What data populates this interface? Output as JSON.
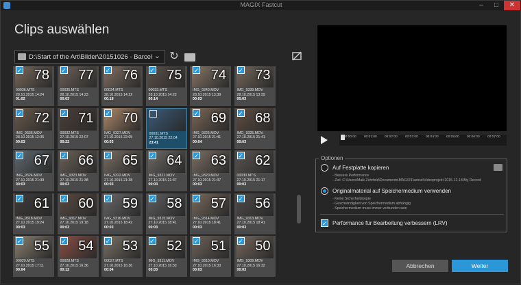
{
  "window": {
    "title": "MAGIX Fastcut",
    "min": "–",
    "max": "□",
    "close": "✕"
  },
  "heading": "Clips auswählen",
  "path": {
    "value": "D:\\Start of the Art\\Bilder\\20151026 - Barcelona\\Vid",
    "caret": "⌄"
  },
  "icons": {
    "refresh": "refresh-icon",
    "browse": "folder-icon",
    "no_preview": "no-preview-icon"
  },
  "clips": [
    {
      "n": "78",
      "name": "00036.MTS",
      "date": "28.10.2015 14:24",
      "dur": "01:02",
      "checked": true,
      "color": "#7d6a5a"
    },
    {
      "n": "77",
      "name": "00035.MTS",
      "date": "28.10.2015 14:23",
      "dur": "00:03",
      "checked": true,
      "color": "#6e6258"
    },
    {
      "n": "76",
      "name": "00034.MTS",
      "date": "28.10.2015 14:22",
      "dur": "00:18",
      "checked": true,
      "color": "#857264"
    },
    {
      "n": "75",
      "name": "00033.MTS",
      "date": "28.10.2015 14:22",
      "dur": "00:14",
      "checked": true,
      "color": "#5c5048"
    },
    {
      "n": "74",
      "name": "IMG_9340.MOV",
      "date": "28.10.2015 13:39",
      "dur": "00:03",
      "checked": true,
      "color": "#8a7868"
    },
    {
      "n": "73",
      "name": "IMG_9339.MOV",
      "date": "28.10.2015 13:39",
      "dur": "00:03",
      "checked": true,
      "color": "#77695c"
    },
    {
      "n": "72",
      "name": "IMG_9336.MOV",
      "date": "28.10.2015 12:35",
      "dur": "00:03",
      "checked": true,
      "color": "#6a5a4c"
    },
    {
      "n": "71",
      "name": "00032.MTS",
      "date": "27.10.2015 22:07",
      "dur": "00:22",
      "checked": true,
      "color": "#4b3f38"
    },
    {
      "n": "70",
      "name": "IMG_9327.MOV",
      "date": "27.10.2015 22:05",
      "dur": "00:03",
      "checked": true,
      "color": "#b08a6a"
    },
    {
      "n": "",
      "name": "00031.MTS",
      "date": "27.10.2015 22:04",
      "dur": "23:41",
      "checked": false,
      "selected": true,
      "color": "#3a5a78"
    },
    {
      "n": "69",
      "name": "IMG_9326.MOV",
      "date": "27.10.2015 21:41",
      "dur": "00:04",
      "checked": true,
      "color": "#7a6656"
    },
    {
      "n": "68",
      "name": "IMG_9325.MOV",
      "date": "27.10.2015 21:41",
      "dur": "00:03",
      "checked": true,
      "color": "#5e4e42"
    },
    {
      "n": "67",
      "name": "IMG_9324.MOV",
      "date": "27.10.2015 21:39",
      "dur": "00:03",
      "checked": true,
      "color": "#606a70"
    },
    {
      "n": "66",
      "name": "IMG_9323.MOV",
      "date": "27.10.2015 21:38",
      "dur": "00:03",
      "checked": true,
      "color": "#6c6258"
    },
    {
      "n": "65",
      "name": "IMG_9322.MOV",
      "date": "27.10.2015 21:38",
      "dur": "00:03",
      "checked": true,
      "color": "#7a6e62"
    },
    {
      "n": "64",
      "name": "IMG_9321.MOV",
      "date": "27.10.2015 21:37",
      "dur": "00:03",
      "checked": true,
      "color": "#6e6a66"
    },
    {
      "n": "63",
      "name": "IMG_9320.MOV",
      "date": "27.10.2015 21:37",
      "dur": "00:03",
      "checked": true,
      "color": "#7c7064"
    },
    {
      "n": "62",
      "name": "00030.MTS",
      "date": "27.10.2015 21:17",
      "dur": "00:03",
      "checked": true,
      "color": "#5a5450"
    },
    {
      "n": "61",
      "name": "IMG_9318.MOV",
      "date": "27.10.2015 19:24",
      "dur": "00:03",
      "checked": true,
      "color": "#3e3a38"
    },
    {
      "n": "60",
      "name": "IMG_9317.MOV",
      "date": "27.10.2015 19:18",
      "dur": "00:03",
      "checked": true,
      "color": "#584a40"
    },
    {
      "n": "59",
      "name": "IMG_9316.MOV",
      "date": "27.10.2015 18:42",
      "dur": "00:03",
      "checked": true,
      "color": "#6a6a6a"
    },
    {
      "n": "58",
      "name": "IMG_9315.MOV",
      "date": "27.10.2015 18:41",
      "dur": "00:03",
      "checked": true,
      "color": "#5e5e60"
    },
    {
      "n": "57",
      "name": "IMG_9314.MOV",
      "date": "27.10.2015 18:41",
      "dur": "00:03",
      "checked": true,
      "color": "#7a6a5c"
    },
    {
      "n": "56",
      "name": "IMG_9313.MOV",
      "date": "27.10.2015 18:41",
      "dur": "00:03",
      "checked": true,
      "color": "#4e4a48"
    },
    {
      "n": "55",
      "name": "00029.MTS",
      "date": "27.10.2015 17:11",
      "dur": "00:04",
      "checked": true,
      "color": "#8a8070"
    },
    {
      "n": "54",
      "name": "00028.MTS",
      "date": "27.10.2015 16:36",
      "dur": "00:12",
      "checked": true,
      "color": "#8a5044"
    },
    {
      "n": "53",
      "name": "00027.MTS",
      "date": "27.10.2015 16:36",
      "dur": "00:04",
      "checked": true,
      "color": "#7a7266"
    },
    {
      "n": "52",
      "name": "IMG_9311.MOV",
      "date": "27.10.2015 16:33",
      "dur": "00:03",
      "checked": true,
      "color": "#5c5650"
    },
    {
      "n": "51",
      "name": "IMG_9310.MOV",
      "date": "27.10.2015 16:33",
      "dur": "00:03",
      "checked": true,
      "color": "#6e625a"
    },
    {
      "n": "50",
      "name": "IMG_9309.MOV",
      "date": "27.10.2015 16:32",
      "dur": "00:03",
      "checked": true,
      "color": "#76685c"
    }
  ],
  "player": {
    "play": "play-icon",
    "ticks": [
      "00:00:00",
      "00:01:00",
      "00:02:00",
      "00:03:00",
      "00:04:00",
      "00:05:00",
      "00:06:00",
      "00:07:00"
    ]
  },
  "options": {
    "legend": "Optionen",
    "copy": {
      "label": "Auf Festplatte kopieren",
      "line1": "- Bessere Performance",
      "line2": "- Ziel: C:\\Users\\Maik Zehrfeld\\Documents\\MAGIX\\Fastcut\\Videoprojekt 2015-12-14\\My Record",
      "selected": false
    },
    "original": {
      "label": "Originalmaterial auf Speichermedium verwenden",
      "line1": "- Keine Sicherheitskopie",
      "line2": "- Geschwindigkeit von Speichermedium abhängig",
      "line3": "- Speichermedium muss immer verbunden sein",
      "selected": true
    },
    "lrv": {
      "label": "Performance für Bearbeitung verbessern (LRV)",
      "checked": true
    }
  },
  "buttons": {
    "cancel": "Abbrechen",
    "next": "Weiter"
  },
  "colors": {
    "accent": "#2b96d8",
    "background": "#262626"
  }
}
